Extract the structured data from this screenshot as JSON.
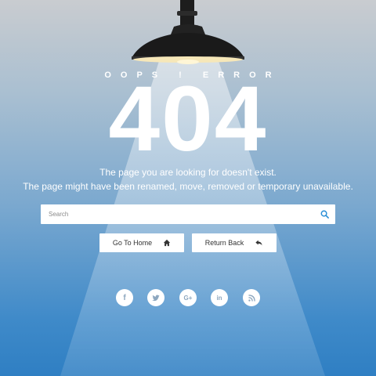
{
  "header": {
    "subtitle": "OOPS ! ERROR",
    "code": "404"
  },
  "message": {
    "line1": "The page you are looking for doesn't exist.",
    "line2": "The page might have been renamed, move, removed or temporary unavailable."
  },
  "search": {
    "placeholder": "Search",
    "icon": "search-icon",
    "icon_color": "#2a8fd6"
  },
  "buttons": {
    "home": {
      "label": "Go To Home",
      "icon": "home-icon"
    },
    "back": {
      "label": "Return Back",
      "icon": "reply-icon"
    }
  },
  "social": [
    {
      "name": "facebook",
      "glyph": "f"
    },
    {
      "name": "twitter",
      "glyph": "twitter-bird"
    },
    {
      "name": "google-plus",
      "glyph": "G+"
    },
    {
      "name": "linkedin",
      "glyph": "in"
    },
    {
      "name": "rss",
      "glyph": "rss"
    }
  ],
  "colors": {
    "background_top": "#c9ccd0",
    "background_bottom": "#2f7fc3",
    "text": "#ffffff",
    "lamp": "#1c1c1c"
  }
}
